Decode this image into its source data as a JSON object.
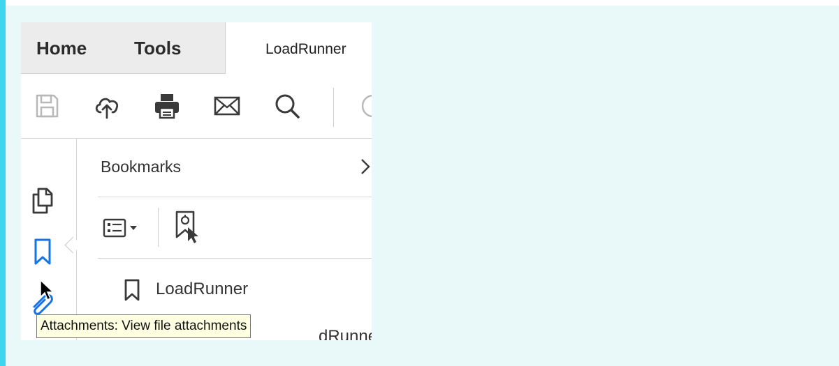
{
  "tabs": {
    "home_label": "Home",
    "tools_label": "Tools",
    "document_label": "LoadRunner"
  },
  "toolbar": {
    "icons": [
      "save-icon",
      "cloud-upload-icon",
      "print-icon",
      "email-icon",
      "search-icon",
      "clock-icon"
    ]
  },
  "rail": {
    "icons": [
      "page-thumbnails-icon",
      "bookmarks-icon",
      "attachments-icon"
    ]
  },
  "bookmarks_panel": {
    "title": "Bookmarks",
    "items": [
      {
        "label": "LoadRunner"
      },
      {
        "label": "dRunne"
      }
    ]
  },
  "tooltip": {
    "text": "Attachments: View file attachments"
  },
  "colors": {
    "accent": "#3dd6ee",
    "active_icon": "#1473e6",
    "tooltip_bg": "#ffffe1"
  }
}
